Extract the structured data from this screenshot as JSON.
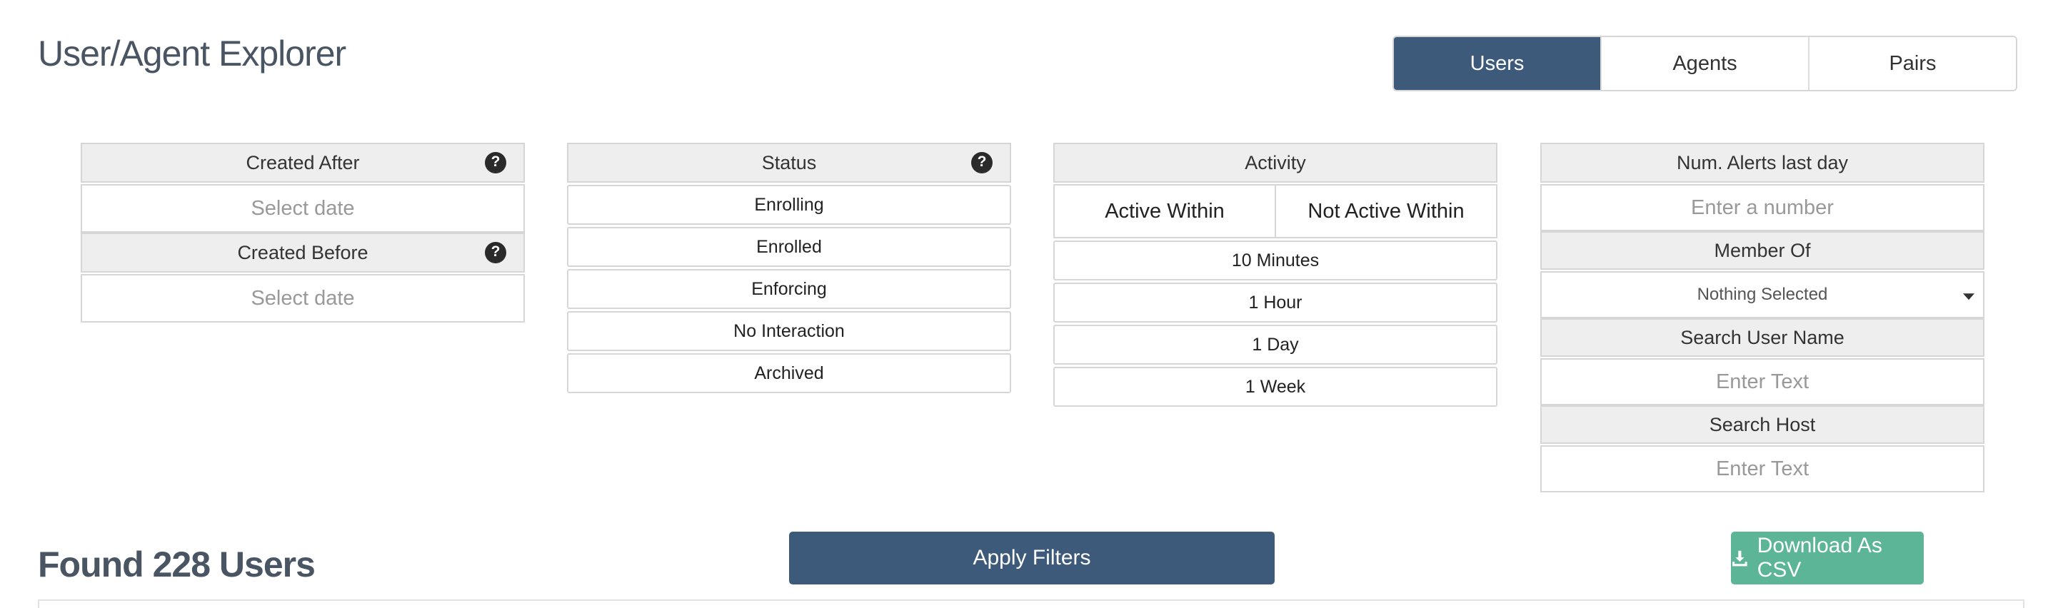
{
  "title": "User/Agent Explorer",
  "view_tabs": [
    {
      "label": "Users",
      "active": true
    },
    {
      "label": "Agents",
      "active": false
    },
    {
      "label": "Pairs",
      "active": false
    }
  ],
  "filters": {
    "created_after": {
      "label": "Created After",
      "placeholder": "Select date"
    },
    "created_before": {
      "label": "Created Before",
      "placeholder": "Select date"
    },
    "help_glyph": "?",
    "status": {
      "label": "Status",
      "options": [
        "Enrolling",
        "Enrolled",
        "Enforcing",
        "No Interaction",
        "Archived"
      ]
    },
    "activity": {
      "label": "Activity",
      "toggle": [
        "Active Within",
        "Not Active Within"
      ],
      "options": [
        "10 Minutes",
        "1 Hour",
        "1 Day",
        "1 Week"
      ]
    },
    "num_alerts": {
      "label": "Num. Alerts last day",
      "placeholder": "Enter a number"
    },
    "member_of": {
      "label": "Member Of",
      "selected": "Nothing Selected"
    },
    "search_user": {
      "label": "Search User Name",
      "placeholder": "Enter Text"
    },
    "search_host": {
      "label": "Search Host",
      "placeholder": "Enter Text"
    }
  },
  "results": {
    "found_text": "Found 228 Users"
  },
  "actions": {
    "apply_label": "Apply Filters",
    "download_label": "Download As CSV"
  },
  "colors": {
    "primary": "#3e5a7a",
    "success": "#5cb596",
    "header_bg": "#eeeeee"
  }
}
